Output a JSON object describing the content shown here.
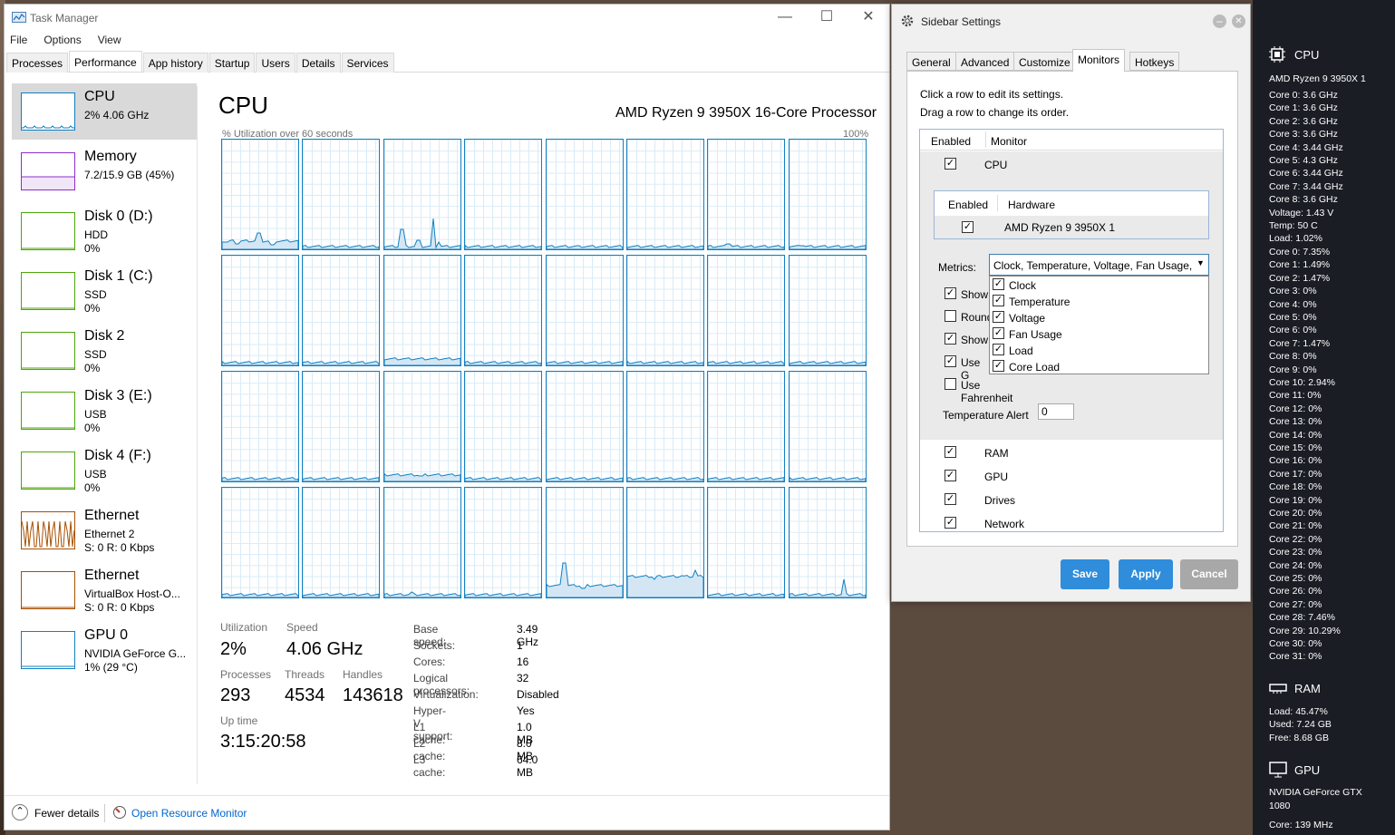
{
  "taskmanager": {
    "title": "Task Manager",
    "menu": [
      "File",
      "Options",
      "View"
    ],
    "tabs": [
      "Processes",
      "Performance",
      "App history",
      "Startup",
      "Users",
      "Details",
      "Services"
    ],
    "sidebar": [
      {
        "name": "CPU",
        "sub1": "2% 4.06 GHz",
        "sub2": "",
        "color": "#1180c2"
      },
      {
        "name": "Memory",
        "sub1": "7.2/15.9 GB (45%)",
        "sub2": "",
        "color": "#8b2fc9"
      },
      {
        "name": "Disk 0 (D:)",
        "sub1": "HDD",
        "sub2": "0%",
        "color": "#4da60c"
      },
      {
        "name": "Disk 1 (C:)",
        "sub1": "SSD",
        "sub2": "0%",
        "color": "#4da60c"
      },
      {
        "name": "Disk 2",
        "sub1": "SSD",
        "sub2": "0%",
        "color": "#4da60c"
      },
      {
        "name": "Disk 3 (E:)",
        "sub1": "USB",
        "sub2": "0%",
        "color": "#4da60c"
      },
      {
        "name": "Disk 4 (F:)",
        "sub1": "USB",
        "sub2": "0%",
        "color": "#4da60c"
      },
      {
        "name": "Ethernet",
        "sub1": "Ethernet 2",
        "sub2": "S: 0 R: 0 Kbps",
        "color": "#a74f01"
      },
      {
        "name": "Ethernet",
        "sub1": "VirtualBox Host-O...",
        "sub2": "S: 0 R: 0 Kbps",
        "color": "#a74f01"
      },
      {
        "name": "GPU 0",
        "sub1": "NVIDIA GeForce G...",
        "sub2": "1% (29 °C)",
        "color": "#1180c2"
      }
    ],
    "cpu": {
      "heading": "CPU",
      "model": "AMD Ryzen 9 3950X 16-Core Processor",
      "graph_label": "% Utilization over 60 seconds",
      "graph_max": "100%",
      "utilization_label": "Utilization",
      "utilization": "2%",
      "speed_label": "Speed",
      "speed": "4.06 GHz",
      "processes_label": "Processes",
      "processes": "293",
      "threads_label": "Threads",
      "threads": "4534",
      "handles_label": "Handles",
      "handles": "143618",
      "uptime_label": "Up time",
      "uptime": "3:15:20:58",
      "specs": [
        [
          "Base speed:",
          "3.49 GHz"
        ],
        [
          "Sockets:",
          "1"
        ],
        [
          "Cores:",
          "16"
        ],
        [
          "Logical processors:",
          "32"
        ],
        [
          "Virtualization:",
          "Disabled"
        ],
        [
          "Hyper-V support:",
          "Yes"
        ],
        [
          "L1 cache:",
          "1.0 MB"
        ],
        [
          "L2 cache:",
          "8.0 MB"
        ],
        [
          "L3 cache:",
          "64.0 MB"
        ]
      ]
    },
    "footer": {
      "fewer": "Fewer details",
      "monitor": "Open Resource Monitor"
    }
  },
  "sidebar_settings": {
    "title": "Sidebar Settings",
    "tabs": [
      "General",
      "Advanced",
      "Customize",
      "Monitors",
      "Hotkeys"
    ],
    "help1": "Click a row to edit its settings.",
    "help2": "Drag a row to change its order.",
    "col_enabled": "Enabled",
    "col_monitor": "Monitor",
    "col_hardware": "Hardware",
    "cpu_row": "CPU",
    "hardware_row": "AMD Ryzen 9 3950X 1",
    "metrics_label": "Metrics:",
    "metrics_value": "Clock, Temperature, Voltage, Fan Usage, L",
    "metric_options": [
      "Clock",
      "Temperature",
      "Voltage",
      "Fan Usage",
      "Load",
      "Core Load"
    ],
    "opts": [
      {
        "label": "Show",
        "checked": true
      },
      {
        "label": "Round",
        "checked": false
      },
      {
        "label": "Show",
        "checked": true
      },
      {
        "label": "Use G",
        "checked": true
      },
      {
        "label": "Use Fahrenheit",
        "checked": false
      }
    ],
    "temp_alert_label": "Temperature Alert",
    "temp_alert_value": "0",
    "other_monitors": [
      "RAM",
      "GPU",
      "Drives",
      "Network"
    ],
    "save": "Save",
    "apply": "Apply",
    "cancel": "Cancel"
  },
  "rsidebar": {
    "cpu_head": "CPU",
    "cpu_model": "AMD Ryzen 9 3950X 1",
    "clocks": [
      "Core 0: 3.6 GHz",
      "Core 1: 3.6 GHz",
      "Core 2: 3.6 GHz",
      "Core 3: 3.6 GHz",
      "Core 4: 3.44 GHz",
      "Core 5: 4.3 GHz",
      "Core 6: 3.44 GHz",
      "Core 7: 3.44 GHz",
      "Core 8: 3.6 GHz",
      "Voltage: 1.43 V",
      "Temp: 50 C",
      "Load: 1.02%"
    ],
    "loads": [
      "Core 0: 7.35%",
      "Core 1: 1.49%",
      "Core 2: 1.47%",
      "Core 3: 0%",
      "Core 4: 0%",
      "Core 5: 0%",
      "Core 6: 0%",
      "Core 7: 1.47%",
      "Core 8: 0%",
      "Core 9: 0%",
      "Core 10: 2.94%",
      "Core 11: 0%",
      "Core 12: 0%",
      "Core 13: 0%",
      "Core 14: 0%",
      "Core 15: 0%",
      "Core 16: 0%",
      "Core 17: 0%",
      "Core 18: 0%",
      "Core 19: 0%",
      "Core 20: 0%",
      "Core 21: 0%",
      "Core 22: 0%",
      "Core 23: 0%",
      "Core 24: 0%",
      "Core 25: 0%",
      "Core 26: 0%",
      "Core 27: 0%",
      "Core 28: 7.46%",
      "Core 29: 10.29%",
      "Core 30: 0%",
      "Core 31: 0%"
    ],
    "ram_head": "RAM",
    "ram": [
      "Load: 45.47%",
      "Used: 7.24 GB",
      "Free: 8.68 GB"
    ],
    "gpu_head": "GPU",
    "gpu_model1": "NVIDIA GeForce GTX",
    "gpu_model2": "1080",
    "gpu_core": "Core: 139 MHz"
  }
}
